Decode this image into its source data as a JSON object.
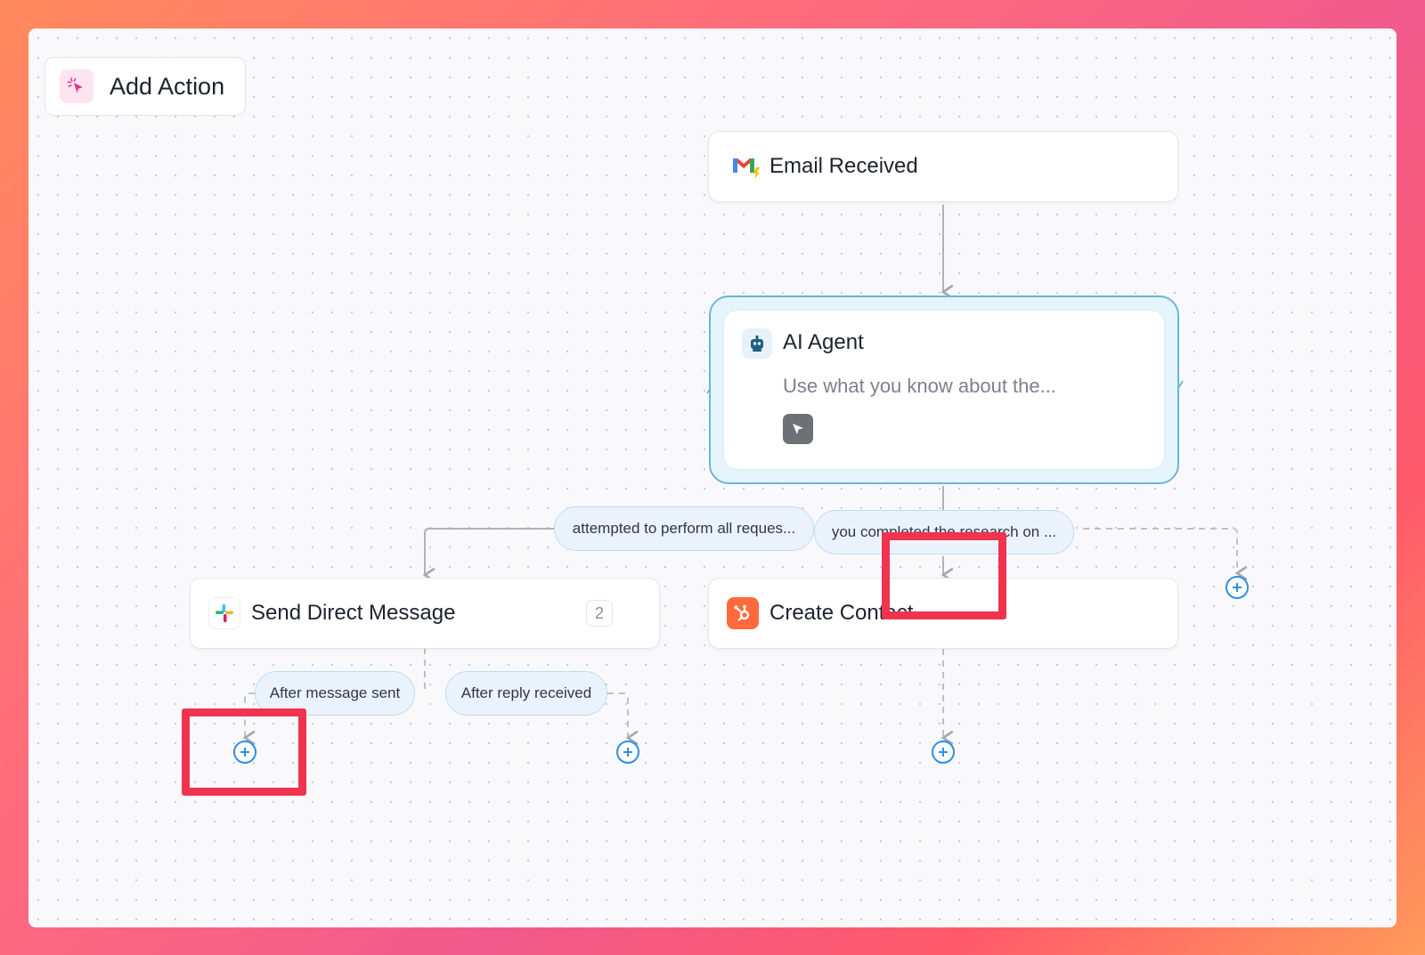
{
  "toolbar": {
    "add_action_label": "Add Action"
  },
  "nodes": {
    "trigger": {
      "label": "Email Received",
      "icon": "gmail-icon"
    },
    "agent": {
      "title": "AI Agent",
      "description": "Use what you know about the...",
      "icon": "robot-icon",
      "tool_icon": "cursor-icon"
    },
    "slack": {
      "label": "Send Direct Message",
      "badge": "2",
      "icon": "slack-icon"
    },
    "hubspot": {
      "label": "Create Contact",
      "icon": "hubspot-icon"
    }
  },
  "branches": {
    "agent_left": "attempted to perform all reques...",
    "agent_middle": "you completed the research on ...",
    "slack_left": "After message sent",
    "slack_right": "After reply received"
  },
  "colors": {
    "accent": "#2f8ee6",
    "agent_border": "#6ab6dd",
    "highlight": "#f0334e",
    "hubspot": "#ff6a3c"
  }
}
